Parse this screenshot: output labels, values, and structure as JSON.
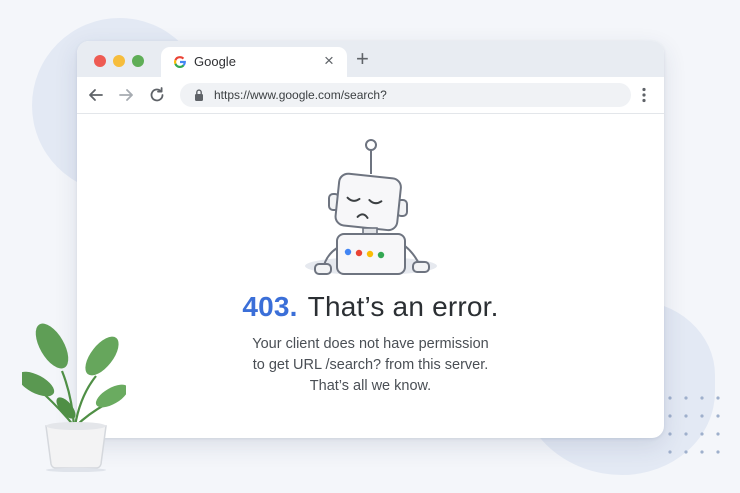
{
  "browser": {
    "tab": {
      "title": "Google",
      "favicon_icon": "google-g-icon",
      "close_symbol": "×"
    },
    "new_tab_symbol": "+",
    "address_bar": {
      "url": "https://www.google.com/search?"
    }
  },
  "error_page": {
    "code": "403.",
    "headline": "That’s an error.",
    "message_lines": [
      "Your client does not have permission",
      "to get URL /search? from this server.",
      "That’s all we know."
    ]
  },
  "colors": {
    "error_code_blue": "#3b6fd8",
    "robot_dots": [
      "#4285f4",
      "#ea4335",
      "#fbbc05",
      "#34a853"
    ]
  }
}
